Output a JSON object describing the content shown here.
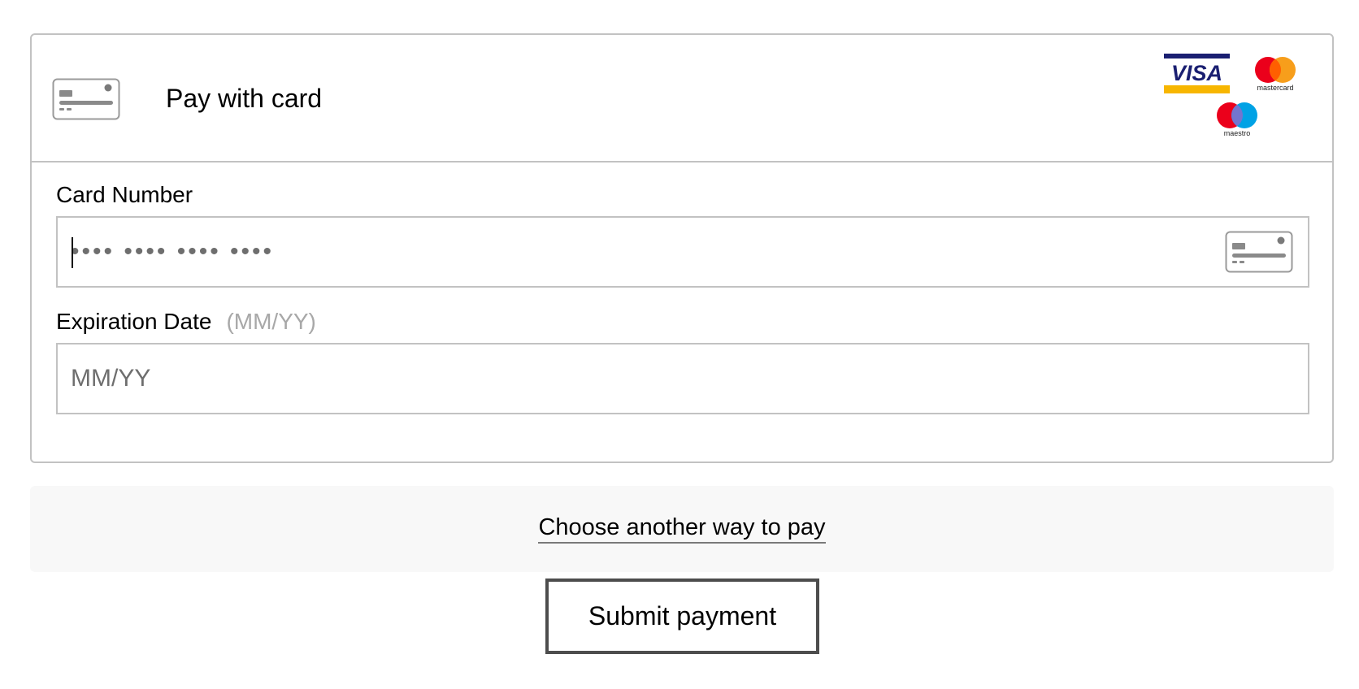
{
  "header": {
    "title": "Pay with card",
    "card_icon": "credit-card-icon",
    "brands": [
      {
        "name": "VISA",
        "icon": "visa-logo"
      },
      {
        "name": "mastercard",
        "icon": "mastercard-logo"
      },
      {
        "name": "maestro",
        "icon": "maestro-logo"
      }
    ]
  },
  "card_number": {
    "label": "Card Number",
    "placeholder": "•••• •••• •••• ••••",
    "value": "",
    "icon": "credit-card-icon"
  },
  "expiry": {
    "label": "Expiration Date",
    "hint": "(MM/YY)",
    "placeholder": "MM/YY",
    "value": ""
  },
  "alternate": {
    "link_label": "Choose another way to pay"
  },
  "submit": {
    "label": "Submit payment"
  },
  "colors": {
    "border": "#c2c2c2",
    "hint_text": "#a8a8a8",
    "alt_bar_background": "#f8f8f8",
    "button_border": "#4d4d4d",
    "visa_blue": "#1a1f71",
    "visa_gold": "#f7b600",
    "mastercard_red": "#eb001b",
    "mastercard_orange": "#f79e1b",
    "maestro_blue": "#00a2e5"
  }
}
